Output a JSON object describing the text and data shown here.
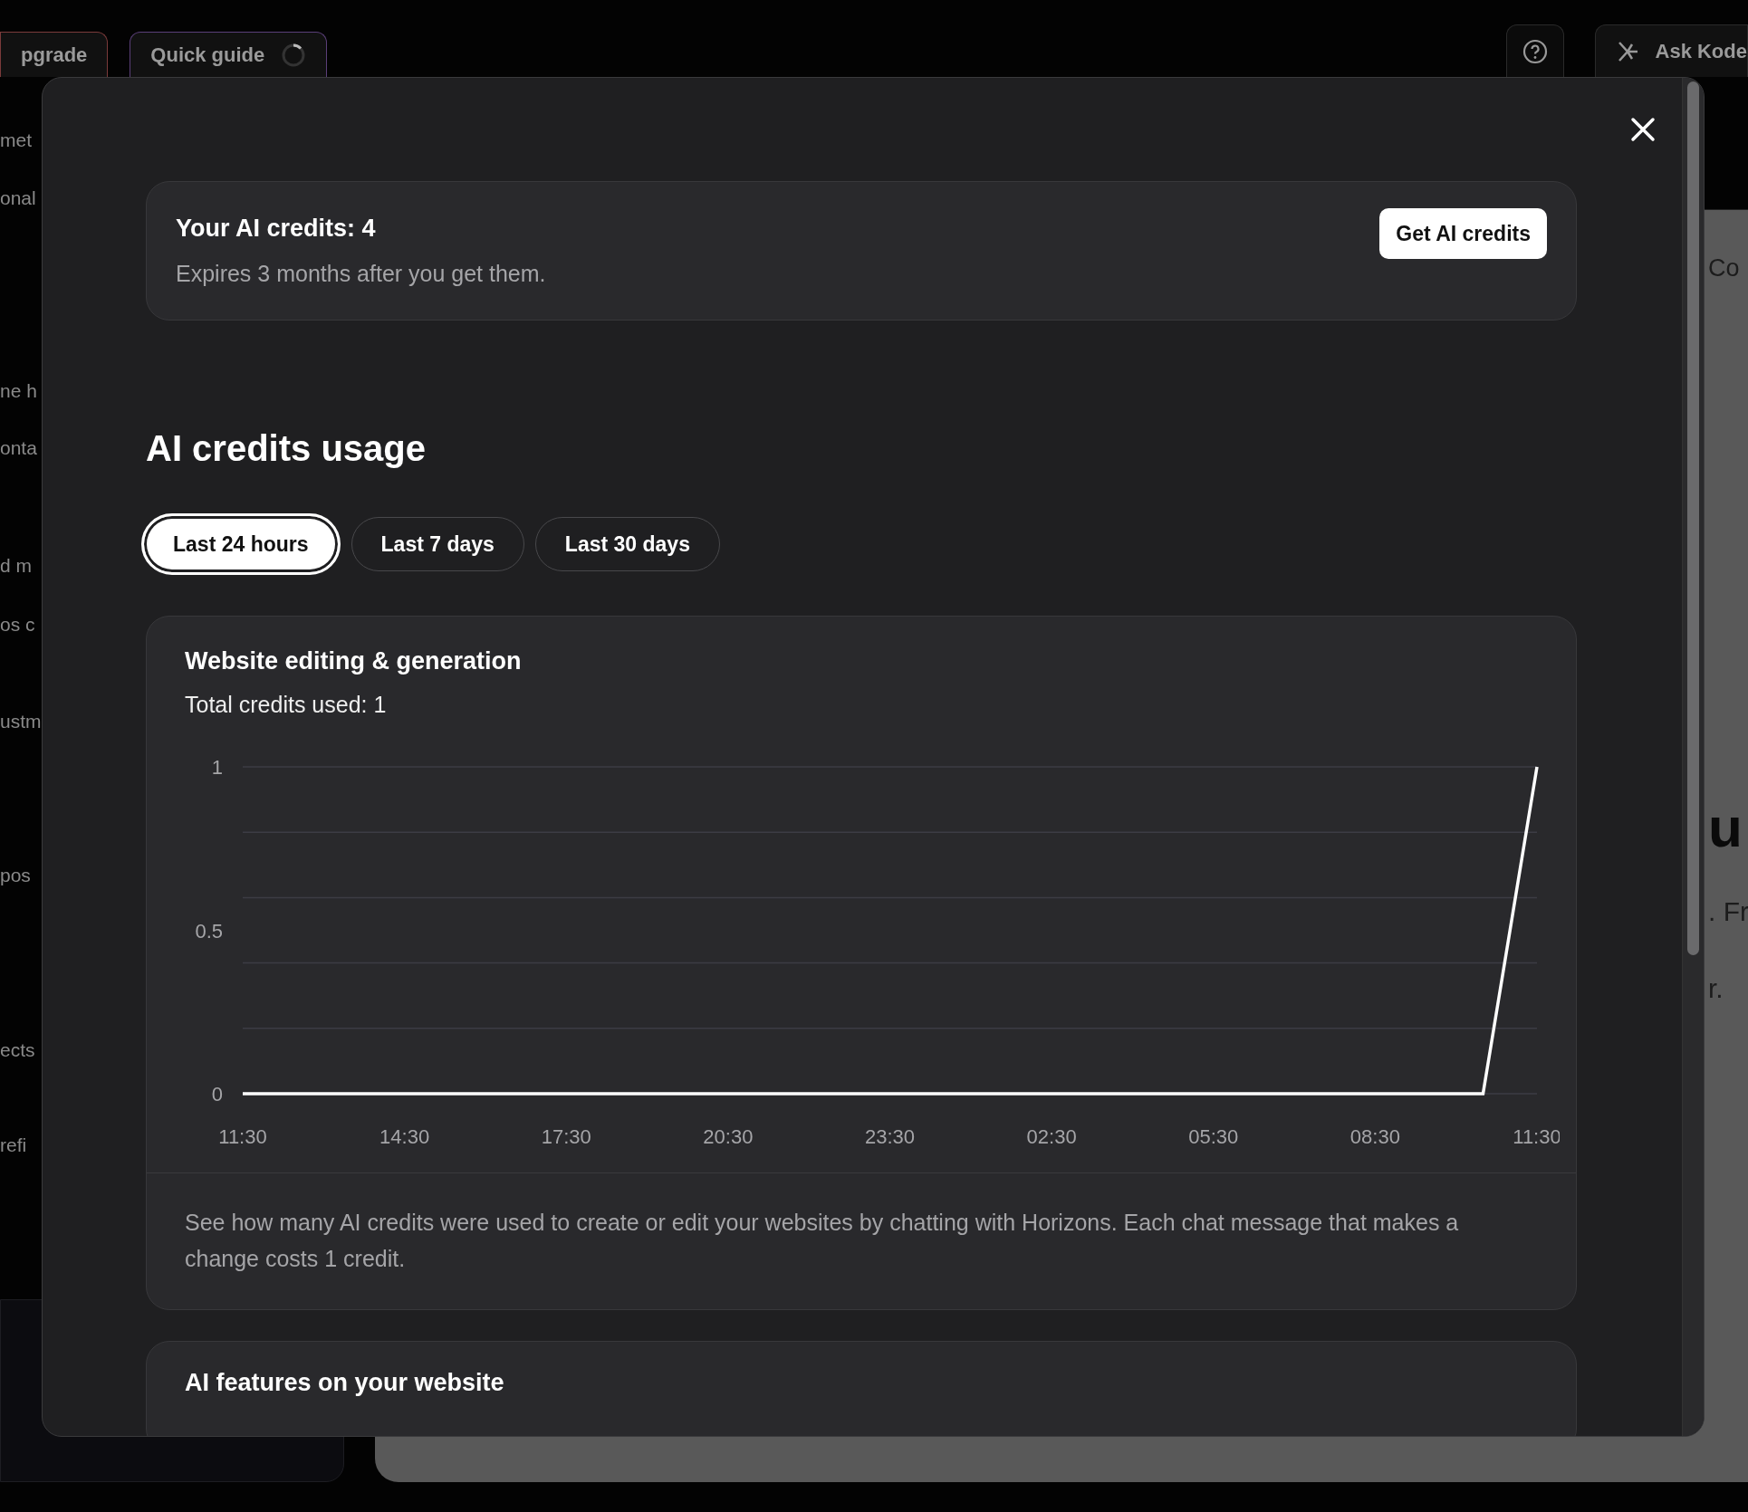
{
  "top_bar": {
    "left_buttons": [
      {
        "label": "pgrade",
        "kind": "upgrade"
      },
      {
        "label": "Quick guide",
        "kind": "guide"
      }
    ],
    "right_buttons": [
      {
        "label": "Ask Kode"
      }
    ]
  },
  "background": {
    "left_fragments": [
      "met",
      "onal",
      "ne h",
      "onta",
      "d m",
      "os c",
      "ustm",
      "pos",
      "ects",
      "refi"
    ],
    "right_fragments": [
      "Co",
      "u",
      ". Fr",
      "r."
    ]
  },
  "modal": {
    "credits_card": {
      "title": "Your AI credits: 4",
      "subtitle": "Expires 3 months after you get them.",
      "button": "Get AI credits"
    },
    "usage_heading": "AI credits usage",
    "tabs": [
      {
        "label": "Last 24 hours",
        "selected": true
      },
      {
        "label": "Last 7 days",
        "selected": false
      },
      {
        "label": "Last 30 days",
        "selected": false
      }
    ],
    "usage_card": {
      "title": "Website editing & generation",
      "total": "Total credits used: 1",
      "chart_data": {
        "type": "line",
        "categories": [
          "11:30",
          null,
          null,
          "14:30",
          null,
          null,
          "17:30",
          null,
          null,
          "20:30",
          null,
          null,
          "23:30",
          null,
          null,
          "02:30",
          null,
          null,
          "05:30",
          null,
          null,
          "08:30",
          null,
          null,
          "11:30"
        ],
        "series": [
          {
            "color": "#ffffff",
            "values": [
              0,
              0,
              0,
              0,
              0,
              0,
              0,
              0,
              0,
              0,
              0,
              0,
              0,
              0,
              0,
              0,
              0,
              0,
              0,
              0,
              0,
              0,
              0,
              0,
              1
            ]
          }
        ],
        "ylim": [
          0,
          1
        ],
        "yticks": [
          0,
          {
            "value": 0.5,
            "label": "0.5"
          },
          1
        ]
      },
      "description": "See how many AI credits were used to create or edit your websites by chatting with Horizons. Each chat message that makes a change costs 1 credit."
    },
    "features_card": {
      "title": "AI features on your website"
    }
  }
}
